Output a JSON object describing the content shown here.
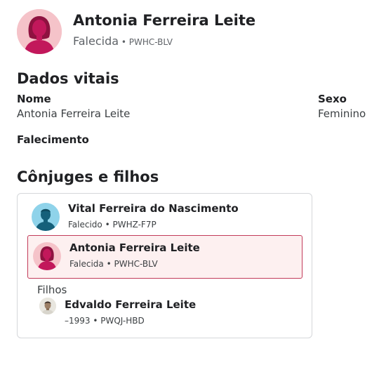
{
  "person": {
    "name": "Antonia Ferreira Leite",
    "status": "Falecida",
    "separator": " • ",
    "id": "PWHC-BLV",
    "avatar_icon": "female-silhouette-icon"
  },
  "vitals": {
    "title": "Dados vitais",
    "name_label": "Nome",
    "name_value": "Antonia Ferreira Leite",
    "sex_label": "Sexo",
    "sex_value": "Feminino",
    "death_label": "Falecimento"
  },
  "family": {
    "title": "Cônjuges e filhos",
    "spouse": {
      "name": "Vital Ferreira do Nascimento",
      "sub": "Falecido • PWHZ-F7P",
      "avatar_icon": "male-silhouette-icon"
    },
    "self": {
      "name": "Antonia Ferreira Leite",
      "sub": "Falecida • PWHC-BLV",
      "avatar_icon": "female-silhouette-icon"
    },
    "children_label": "Filhos",
    "children": [
      {
        "name": "Edvaldo Ferreira Leite",
        "sub": "–1993 • PWQJ-HBD",
        "avatar_icon": "person-photo-icon"
      }
    ]
  },
  "colors": {
    "female_avatar_bg": "#f5c3c9",
    "female_avatar_fg": "#c2185b",
    "male_avatar_bg": "#8fd3ea",
    "male_avatar_fg": "#15607a",
    "highlight_bg": "#fdf0f0",
    "highlight_border": "#c23b5a"
  }
}
